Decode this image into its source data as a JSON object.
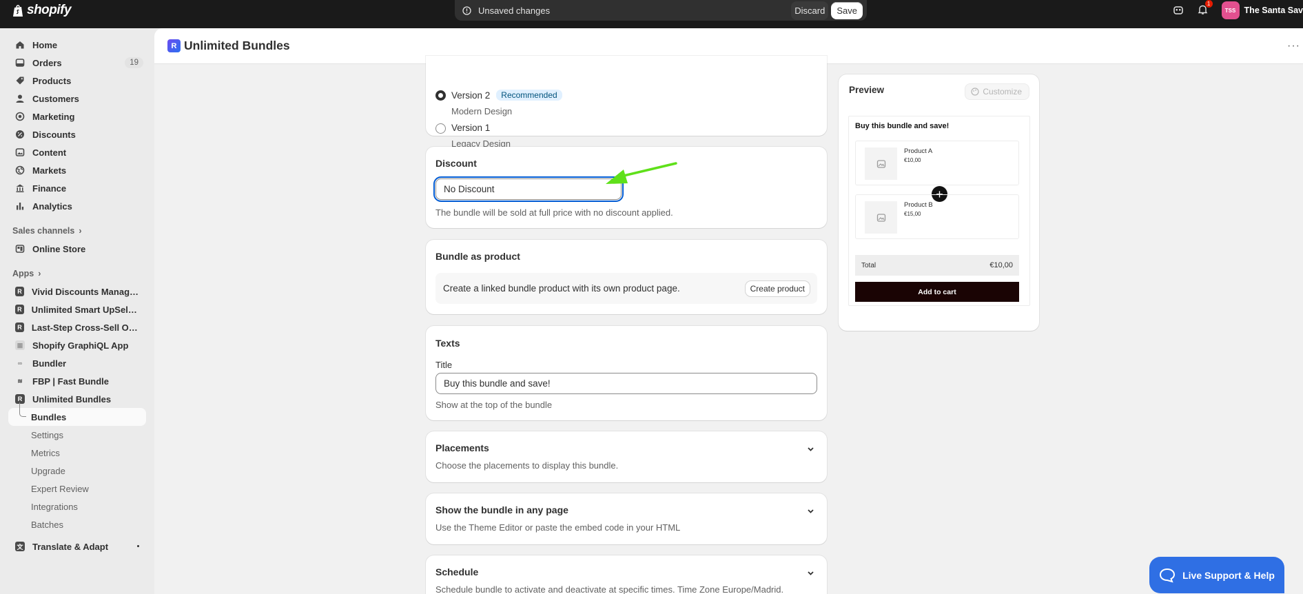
{
  "topbar": {
    "logo_text": "shopify",
    "unsaved_text": "Unsaved changes",
    "discard_label": "Discard",
    "save_label": "Save",
    "notification_count": "1",
    "store_initials": "TSS",
    "store_name": "The Santa Sav"
  },
  "sidebar": {
    "nav": [
      {
        "label": "Home",
        "icon": "home-icon"
      },
      {
        "label": "Orders",
        "icon": "orders-icon",
        "count": "19"
      },
      {
        "label": "Products",
        "icon": "tag-icon"
      },
      {
        "label": "Customers",
        "icon": "person-icon"
      },
      {
        "label": "Marketing",
        "icon": "target-icon"
      },
      {
        "label": "Discounts",
        "icon": "discount-icon"
      },
      {
        "label": "Content",
        "icon": "content-icon"
      },
      {
        "label": "Markets",
        "icon": "globe-icon"
      },
      {
        "label": "Finance",
        "icon": "bank-icon"
      },
      {
        "label": "Analytics",
        "icon": "bar-chart-icon"
      }
    ],
    "sales_channels_label": "Sales channels",
    "online_store": "Online Store",
    "apps_label": "Apps",
    "apps": [
      "Vivid Discounts Manager ...",
      "Unlimited Smart UpSell Of...",
      "Last-Step Cross-Sell Offers",
      "Shopify GraphiQL App",
      "Bundler",
      "FBP | Fast Bundle",
      "Unlimited Bundles"
    ],
    "sub_items": [
      "Bundles",
      "Settings",
      "Metrics",
      "Upgrade",
      "Expert Review",
      "Integrations",
      "Batches"
    ],
    "translate_app": "Translate & Adapt"
  },
  "page": {
    "title": "Unlimited Bundles"
  },
  "design": {
    "v2_label": "Version 2",
    "v2_badge": "Recommended",
    "v2_sub": "Modern Design",
    "v1_label": "Version 1",
    "v1_sub": "Legacy Design"
  },
  "discount": {
    "heading": "Discount",
    "selected": "No Discount",
    "help": "The bundle will be sold at full price with no discount applied."
  },
  "bundle_product": {
    "heading": "Bundle as product",
    "text": "Create a linked bundle product with its own product page.",
    "button": "Create product"
  },
  "texts": {
    "heading": "Texts",
    "title_label": "Title",
    "title_value": "Buy this bundle and save!",
    "title_help": "Show at the top of the bundle"
  },
  "placements": {
    "heading": "Placements",
    "text": "Choose the placements to display this bundle."
  },
  "any_page": {
    "heading": "Show the bundle in any page",
    "text": "Use the Theme Editor or paste the embed code in your HTML"
  },
  "schedule": {
    "heading": "Schedule",
    "text": "Schedule bundle to activate and deactivate at specific times. Time Zone Europe/Madrid."
  },
  "preview": {
    "heading": "Preview",
    "customize": "Customize",
    "bundle_title": "Buy this bundle and save!",
    "products": [
      {
        "name": "Product A",
        "price": "€10,00"
      },
      {
        "name": "Product B",
        "price": "€15,00"
      }
    ],
    "total_label": "Total",
    "total_value": "€10,00",
    "add_to_cart": "Add to cart"
  },
  "support": {
    "label": "Live Support & Help"
  },
  "colors": {
    "topbar": "#1a1a1a",
    "accent_focus": "#005bd3",
    "arrow": "#5fe01a",
    "support": "#2f6fe4"
  }
}
